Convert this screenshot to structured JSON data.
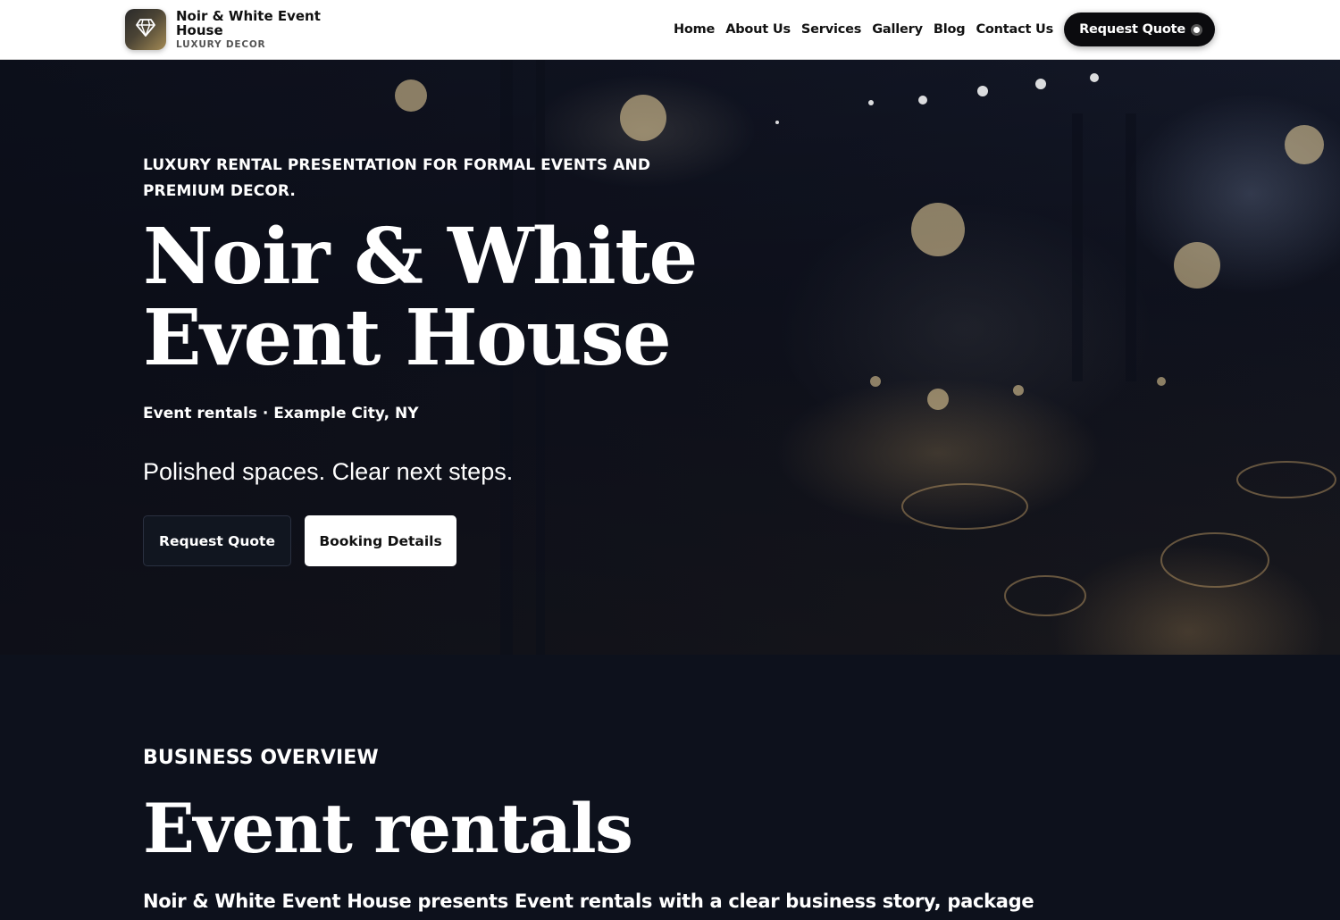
{
  "header": {
    "brand_name": "Noir & White Event House",
    "brand_tagline": "LUXURY DECOR",
    "logo_icon": "diamond-icon",
    "nav": [
      {
        "label": "Home"
      },
      {
        "label": "About Us"
      },
      {
        "label": "Services"
      },
      {
        "label": "Gallery"
      },
      {
        "label": "Blog"
      },
      {
        "label": "Contact Us"
      }
    ],
    "cta_label": "Request Quote"
  },
  "hero": {
    "eyebrow": "LUXURY RENTAL PRESENTATION FOR FORMAL EVENTS AND PREMIUM DECOR.",
    "title": "Noir & White Event House",
    "meta": "Event rentals · Example City, NY",
    "tagline": "Polished spaces. Clear next steps.",
    "primary_button": "Request Quote",
    "secondary_button": "Booking Details"
  },
  "overview": {
    "eyebrow": "BUSINESS OVERVIEW",
    "title": "Event rentals",
    "body": "Noir & White Event House presents Event rentals with a clear business story, package"
  },
  "colors": {
    "header_bg": "#ffffff",
    "hero_overlay": "#0a0c16",
    "section_bg": "#0d111c",
    "cta_bg": "#0b0b0e",
    "logo_gold": "#a38a54"
  }
}
